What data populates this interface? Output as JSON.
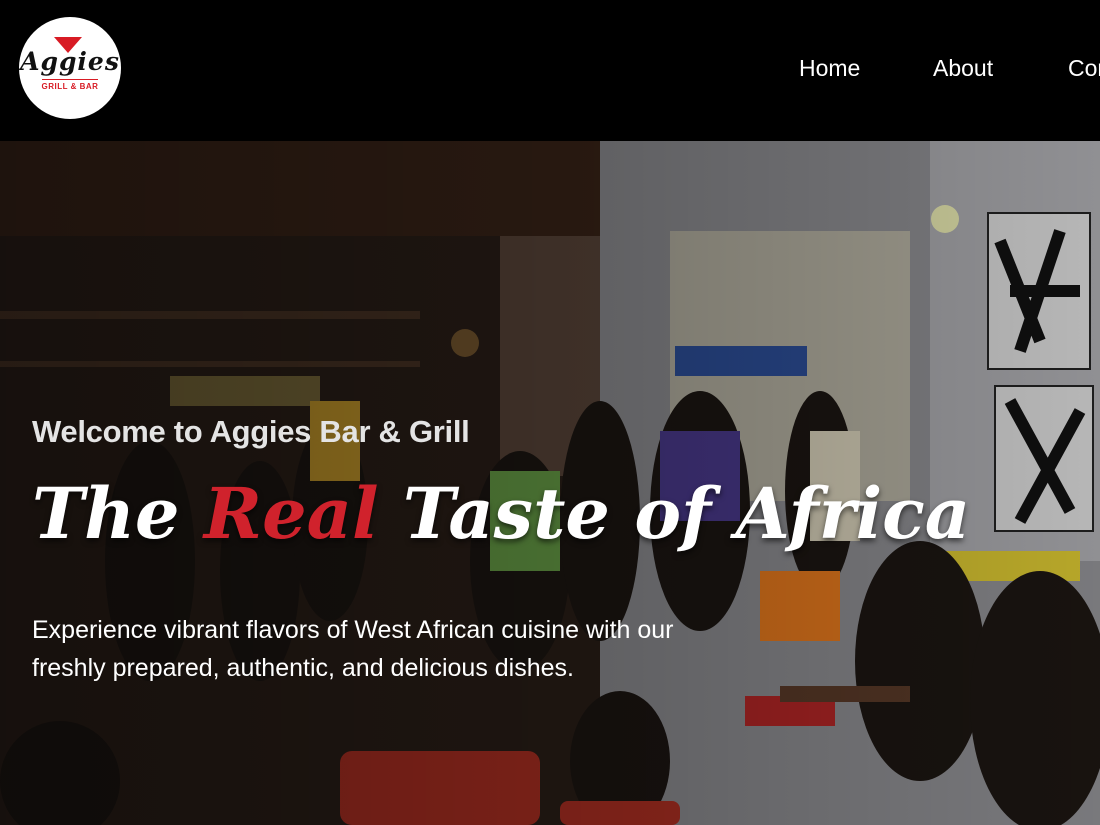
{
  "header": {
    "logo": {
      "word": "Aggies",
      "sub": "GRILL & BAR",
      "alt": "Aggies Grill & Bar logo"
    },
    "nav": [
      {
        "label": "Home"
      },
      {
        "label": "About"
      },
      {
        "label": "Contact"
      }
    ]
  },
  "hero": {
    "kicker": "Welcome to Aggies Bar & Grill",
    "title_before": "The ",
    "title_accent": "Real",
    "title_after": " Taste of Africa",
    "description": "Experience vibrant flavors of West African cuisine with our freshly prepared, authentic, and delicious dishes."
  },
  "colors": {
    "header_bg": "#000000",
    "accent_red": "#d0222c",
    "text_white": "#ffffff"
  }
}
